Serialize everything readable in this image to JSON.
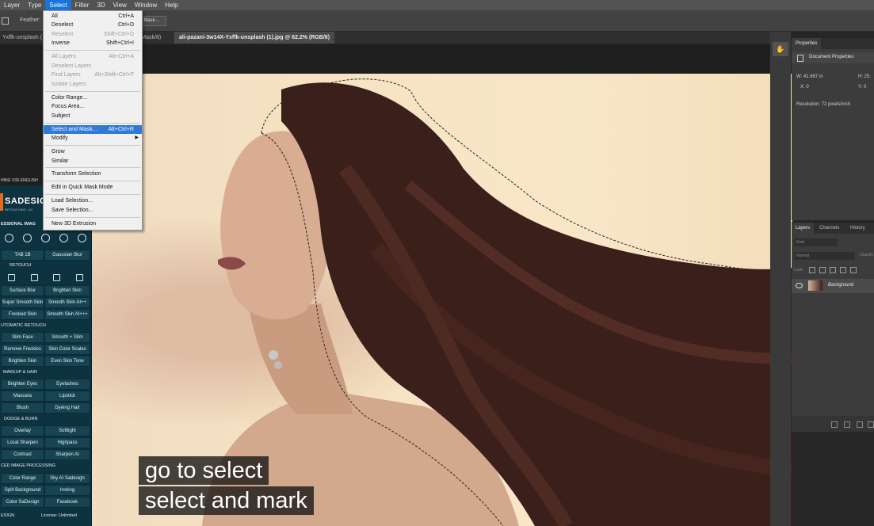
{
  "menubar": {
    "items": [
      "Layer",
      "Type",
      "Select",
      "Filter",
      "3D",
      "View",
      "Window",
      "Help"
    ],
    "active_index": 2
  },
  "options_bar": {
    "feather_label": "Feather:",
    "mask_button": "Mask..."
  },
  "tabs": [
    {
      "label": "Yxffk-unsplash ("
    },
    {
      "label": "r Mask/8)"
    },
    {
      "label": "ali-pazani-3w14X-Yxffk-unsplash (1).jpg @ 62.2% (RGB/8)"
    }
  ],
  "select_menu": {
    "items": [
      {
        "label": "All",
        "shortcut": "Ctrl+A",
        "state": "enabled"
      },
      {
        "label": "Deselect",
        "shortcut": "Ctrl+D",
        "state": "enabled"
      },
      {
        "label": "Reselect",
        "shortcut": "Shift+Ctrl+D",
        "state": "disabled"
      },
      {
        "label": "Inverse",
        "shortcut": "Shift+Ctrl+I",
        "state": "enabled"
      },
      {
        "label": "All Layers",
        "shortcut": "Alt+Ctrl+A",
        "state": "disabled"
      },
      {
        "label": "Deselect Layers",
        "shortcut": "",
        "state": "disabled"
      },
      {
        "label": "Find Layers",
        "shortcut": "Alt+Shift+Ctrl+F",
        "state": "disabled"
      },
      {
        "label": "Isolate Layers",
        "shortcut": "",
        "state": "disabled"
      },
      {
        "label": "Color Range...",
        "shortcut": "",
        "state": "enabled"
      },
      {
        "label": "Focus Area...",
        "shortcut": "",
        "state": "enabled"
      },
      {
        "label": "Subject",
        "shortcut": "",
        "state": "enabled"
      },
      {
        "label": "Select and Mask...",
        "shortcut": "Alt+Ctrl+R",
        "state": "highlighted"
      },
      {
        "label": "Modify",
        "shortcut": "",
        "state": "enabled"
      },
      {
        "label": "Grow",
        "shortcut": "",
        "state": "enabled"
      },
      {
        "label": "Similar",
        "shortcut": "",
        "state": "enabled"
      },
      {
        "label": "Transform Selection",
        "shortcut": "",
        "state": "enabled"
      },
      {
        "label": "Edit in Quick Mask Mode",
        "shortcut": "",
        "state": "enabled"
      },
      {
        "label": "Load Selection...",
        "shortcut": "",
        "state": "enabled"
      },
      {
        "label": "Save Selection...",
        "shortcut": "",
        "state": "enabled"
      },
      {
        "label": "New 3D Extrusion",
        "shortcut": "",
        "state": "enabled"
      }
    ]
  },
  "properties": {
    "tab": "Properties",
    "doc_label": "Document Properties",
    "w": "W:  41.667 in",
    "h": "H:  25.",
    "x": "X:  0",
    "y": "Y:  0",
    "resolution": "Resolution: 72 pixels/inch"
  },
  "layers": {
    "tabs": [
      "Layers",
      "Channels",
      "History"
    ],
    "kind": "Kind",
    "blend": "Normal",
    "opacity": "Opacity",
    "lock": "Lock:",
    "layer_name": "Background"
  },
  "plugin": {
    "title": "HING V3S ENGLISH",
    "brand": "SADESIG",
    "brand_sub": "RETOUCHING - AC",
    "section_top": "ESSIONAL IMAG",
    "sections": {
      "retouch": "RETOUCH",
      "auto": "UTOMATIC RETOUCH",
      "makeup": "MAKEUP & HAIR",
      "dodge": "DODGE & BURN",
      "advanced": "CED IMAGE PROCESSING"
    },
    "buttons": {
      "tab1b": "TAB 1B",
      "gaussian": "Gaussian Blur",
      "surface": "Surface Blur",
      "brighten_skin": "Brighten Skin",
      "super_smooth": "Super Smooth Skin",
      "smooth_ai_pp": "Smooth Skin AI++",
      "freckled": "Frecked Skin",
      "smooth_ai_ppp": "Smooth Skin AI+++",
      "slim_face": "Slim Face",
      "smooth_slim": "Smooth + Slim",
      "remove_freckles": "Remove Freckles",
      "skin_color_scales": "Skin Color Scales",
      "brighten_skin2": "Brighten Skin",
      "even_skin": "Even Skin Tone",
      "brighten_eyes": "Brighten Eyes",
      "eyelashes": "Eyelashes",
      "mascara": "Mascara",
      "lipstick": "Lipstick",
      "blush": "Blush",
      "dyeing_hair": "Dyeing Hair",
      "overlay": "Overlay",
      "softlight": "Softlight",
      "local_sharpen": "Local Sharpen",
      "highpass": "Highpass",
      "contrast": "Contrast",
      "sharpen_ai": "Sharpen AI",
      "color_range": "Color Range",
      "sky_ai": "Sky AI Sadesign",
      "split_bg": "Split Background",
      "ironing": "Ironing",
      "color_sadesign": "Color SaDesign",
      "facebook": "Facebook"
    },
    "footer_left": "ESIGN",
    "footer_right": "License: Unlimited"
  },
  "captions": [
    "go to select",
    "select and mark"
  ],
  "colors": {
    "highlight": "#2f7ad6",
    "plugin_bg": "#0e3340",
    "accent": "#e76a1a"
  }
}
